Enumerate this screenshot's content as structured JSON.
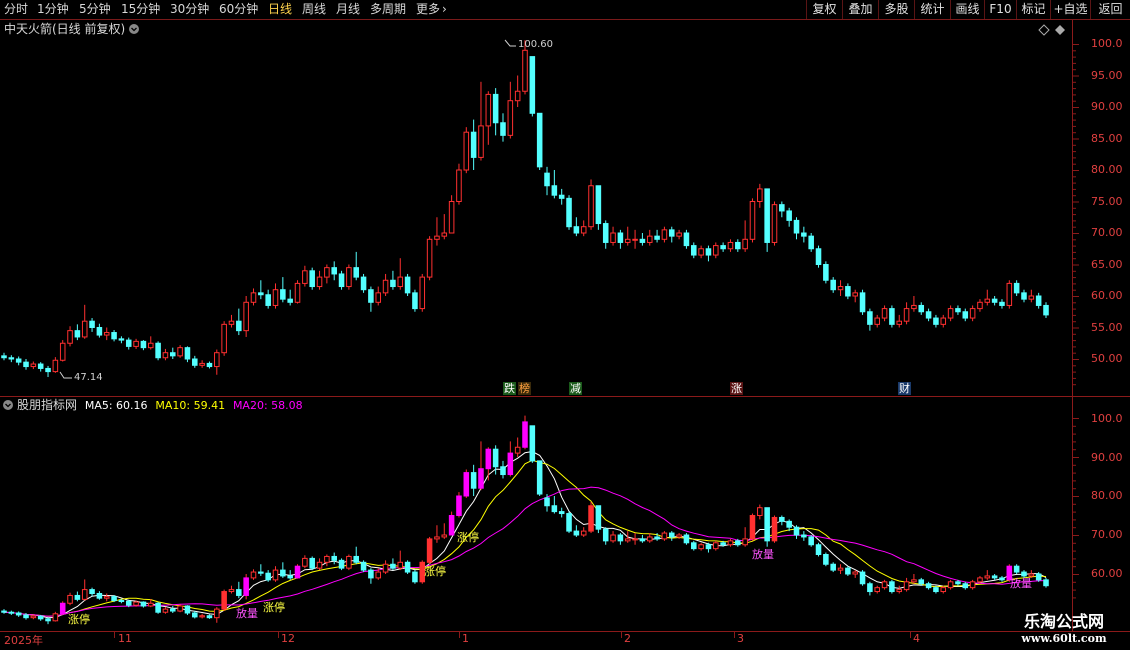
{
  "toolbar": {
    "periods": [
      {
        "label": "分时",
        "active": false
      },
      {
        "label": "1分钟",
        "active": false
      },
      {
        "label": "5分钟",
        "active": false
      },
      {
        "label": "15分钟",
        "active": false
      },
      {
        "label": "30分钟",
        "active": false
      },
      {
        "label": "60分钟",
        "active": false
      },
      {
        "label": "日线",
        "active": true
      },
      {
        "label": "周线",
        "active": false
      },
      {
        "label": "月线",
        "active": false
      },
      {
        "label": "多周期",
        "active": false
      }
    ],
    "more_label": "更多",
    "more_arrow": "›",
    "right_buttons": [
      "复权",
      "叠加",
      "多股",
      "统计",
      "画线",
      "F10",
      "标记",
      "+自选",
      "返回"
    ]
  },
  "main_panel": {
    "title": "中天火箭(日线 前复权)",
    "y_labels": [
      "100.0",
      "95.00",
      "90.00",
      "85.00",
      "80.00",
      "75.00",
      "70.00",
      "65.00",
      "60.00",
      "55.00",
      "50.00"
    ],
    "y_values": [
      100,
      95,
      90,
      85,
      80,
      75,
      70,
      65,
      60,
      55,
      50
    ],
    "high_label": "100.60",
    "low_label": "47.14",
    "events": [
      {
        "text": "跌",
        "bg": "#1a5a1a",
        "fg": "#ffffff"
      },
      {
        "text": "榜",
        "bg": "#3a2a0a",
        "fg": "#ffa040"
      },
      {
        "text": "减",
        "bg": "#1a5a1a",
        "fg": "#ffffff"
      },
      {
        "text": "涨",
        "bg": "#5a1414",
        "fg": "#ffffff"
      },
      {
        "text": "财",
        "bg": "#1a3a6a",
        "fg": "#ffffff"
      }
    ]
  },
  "indicator_panel": {
    "name": "股朋指标网",
    "ma5_label": "MA5: 60.16",
    "ma10_label": "MA10: 59.41",
    "ma20_label": "MA20: 58.08",
    "y_labels": [
      "100.0",
      "90.00",
      "80.00",
      "70.00",
      "60.00"
    ],
    "y_values": [
      100,
      90,
      80,
      70,
      60
    ],
    "zhangting_label": "涨停",
    "fangliang_label": "放量"
  },
  "date_axis": [
    "2025年",
    "11",
    "12",
    "1",
    "2",
    "3",
    "4"
  ],
  "watermark": {
    "line1": "乐淘公式网",
    "line2": "www.60lt.com"
  },
  "colors": {
    "up": "#ff3030",
    "down": "#54ffff",
    "ma5": "#ffffff",
    "ma10": "#ffff00",
    "ma20": "#ff00ff",
    "border": "#8b1a1a",
    "axis_text": "#e04040"
  },
  "chart_data": {
    "type": "candlestick",
    "title": "中天火箭(日线 前复权)",
    "y_range_main": [
      45,
      102
    ],
    "y_range_indicator": [
      52,
      102
    ],
    "candles": [
      {
        "o": 50.5,
        "c": 50.2,
        "h": 51.0,
        "l": 49.8
      },
      {
        "o": 50.2,
        "c": 50.0,
        "h": 50.6,
        "l": 49.5
      },
      {
        "o": 50.0,
        "c": 49.5,
        "h": 50.4,
        "l": 49.0
      },
      {
        "o": 49.5,
        "c": 48.8,
        "h": 50.0,
        "l": 48.3
      },
      {
        "o": 48.8,
        "c": 49.2,
        "h": 49.6,
        "l": 48.4
      },
      {
        "o": 49.2,
        "c": 48.5,
        "h": 49.5,
        "l": 48.0
      },
      {
        "o": 48.5,
        "c": 48.0,
        "h": 48.9,
        "l": 47.14
      },
      {
        "o": 48.0,
        "c": 49.8,
        "h": 50.3,
        "l": 47.8
      },
      {
        "o": 49.8,
        "c": 52.5,
        "h": 53.0,
        "l": 49.6
      },
      {
        "o": 52.5,
        "c": 54.5,
        "h": 55.2,
        "l": 52.0
      },
      {
        "o": 54.5,
        "c": 53.5,
        "h": 55.5,
        "l": 53.0
      },
      {
        "o": 53.5,
        "c": 56.0,
        "h": 58.6,
        "l": 53.2
      },
      {
        "o": 56.0,
        "c": 55.0,
        "h": 56.5,
        "l": 54.3
      },
      {
        "o": 55.0,
        "c": 53.8,
        "h": 55.6,
        "l": 53.4
      },
      {
        "o": 53.8,
        "c": 54.2,
        "h": 55.0,
        "l": 53.0
      },
      {
        "o": 54.2,
        "c": 53.2,
        "h": 54.6,
        "l": 52.8
      },
      {
        "o": 53.2,
        "c": 53.0,
        "h": 53.6,
        "l": 52.5
      },
      {
        "o": 53.0,
        "c": 52.0,
        "h": 53.4,
        "l": 51.5
      },
      {
        "o": 52.0,
        "c": 52.8,
        "h": 53.2,
        "l": 51.6
      },
      {
        "o": 52.8,
        "c": 51.8,
        "h": 53.0,
        "l": 51.4
      },
      {
        "o": 51.8,
        "c": 52.5,
        "h": 53.6,
        "l": 51.5
      },
      {
        "o": 52.5,
        "c": 50.2,
        "h": 52.8,
        "l": 49.8
      },
      {
        "o": 50.2,
        "c": 51.0,
        "h": 51.6,
        "l": 49.8
      },
      {
        "o": 51.0,
        "c": 50.5,
        "h": 51.8,
        "l": 50.0
      },
      {
        "o": 50.5,
        "c": 51.8,
        "h": 52.2,
        "l": 50.2
      },
      {
        "o": 51.8,
        "c": 50.0,
        "h": 52.0,
        "l": 49.5
      },
      {
        "o": 50.0,
        "c": 49.0,
        "h": 50.5,
        "l": 48.6
      },
      {
        "o": 49.0,
        "c": 49.3,
        "h": 49.8,
        "l": 48.6
      },
      {
        "o": 49.3,
        "c": 48.8,
        "h": 49.6,
        "l": 48.5
      },
      {
        "o": 48.8,
        "c": 51.0,
        "h": 51.5,
        "l": 47.5
      },
      {
        "o": 51.0,
        "c": 55.5,
        "h": 56.0,
        "l": 50.5
      },
      {
        "o": 55.5,
        "c": 56.0,
        "h": 57.0,
        "l": 55.0
      },
      {
        "o": 56.0,
        "c": 54.5,
        "h": 58.0,
        "l": 53.8
      },
      {
        "o": 54.5,
        "c": 59.0,
        "h": 60.0,
        "l": 53.5
      },
      {
        "o": 59.0,
        "c": 60.5,
        "h": 61.2,
        "l": 58.5
      },
      {
        "o": 60.5,
        "c": 60.2,
        "h": 62.5,
        "l": 59.5
      },
      {
        "o": 60.2,
        "c": 58.5,
        "h": 61.0,
        "l": 58.0
      },
      {
        "o": 58.5,
        "c": 61.0,
        "h": 62.0,
        "l": 58.0
      },
      {
        "o": 61.0,
        "c": 59.5,
        "h": 63.0,
        "l": 59.0
      },
      {
        "o": 59.5,
        "c": 59.0,
        "h": 61.0,
        "l": 58.5
      },
      {
        "o": 59.0,
        "c": 62.0,
        "h": 62.5,
        "l": 58.8
      },
      {
        "o": 62.0,
        "c": 64.0,
        "h": 64.8,
        "l": 61.5
      },
      {
        "o": 64.0,
        "c": 61.5,
        "h": 64.5,
        "l": 61.0
      },
      {
        "o": 61.5,
        "c": 63.0,
        "h": 64.0,
        "l": 61.0
      },
      {
        "o": 63.0,
        "c": 64.5,
        "h": 65.0,
        "l": 62.0
      },
      {
        "o": 64.5,
        "c": 63.5,
        "h": 65.5,
        "l": 62.5
      },
      {
        "o": 63.5,
        "c": 61.5,
        "h": 64.0,
        "l": 61.0
      },
      {
        "o": 61.5,
        "c": 64.5,
        "h": 65.0,
        "l": 61.0
      },
      {
        "o": 64.5,
        "c": 63.0,
        "h": 67.0,
        "l": 62.5
      },
      {
        "o": 63.0,
        "c": 61.0,
        "h": 63.5,
        "l": 60.5
      },
      {
        "o": 61.0,
        "c": 59.0,
        "h": 61.5,
        "l": 57.5
      },
      {
        "o": 59.0,
        "c": 60.5,
        "h": 61.5,
        "l": 58.5
      },
      {
        "o": 60.5,
        "c": 62.5,
        "h": 63.5,
        "l": 60.0
      },
      {
        "o": 62.5,
        "c": 61.5,
        "h": 64.0,
        "l": 61.0
      },
      {
        "o": 61.5,
        "c": 63.0,
        "h": 66.0,
        "l": 61.0
      },
      {
        "o": 63.0,
        "c": 60.5,
        "h": 63.5,
        "l": 60.0
      },
      {
        "o": 60.5,
        "c": 58.0,
        "h": 61.0,
        "l": 57.5
      },
      {
        "o": 58.0,
        "c": 63.0,
        "h": 63.5,
        "l": 57.5
      },
      {
        "o": 63.0,
        "c": 69.0,
        "h": 69.5,
        "l": 62.5
      },
      {
        "o": 69.0,
        "c": 69.5,
        "h": 72.5,
        "l": 68.0
      },
      {
        "o": 69.5,
        "c": 70.0,
        "h": 73.0,
        "l": 69.0
      },
      {
        "o": 70.0,
        "c": 75.0,
        "h": 76.0,
        "l": 70.0
      },
      {
        "o": 75.0,
        "c": 80.0,
        "h": 81.0,
        "l": 74.5
      },
      {
        "o": 80.0,
        "c": 86.0,
        "h": 86.8,
        "l": 79.5
      },
      {
        "o": 86.0,
        "c": 82.0,
        "h": 88.0,
        "l": 80.0
      },
      {
        "o": 82.0,
        "c": 87.0,
        "h": 94.0,
        "l": 81.5
      },
      {
        "o": 87.0,
        "c": 92.0,
        "h": 92.5,
        "l": 84.0
      },
      {
        "o": 92.0,
        "c": 87.5,
        "h": 93.0,
        "l": 85.5
      },
      {
        "o": 87.5,
        "c": 85.5,
        "h": 89.0,
        "l": 84.5
      },
      {
        "o": 85.5,
        "c": 91.0,
        "h": 94.0,
        "l": 85.0
      },
      {
        "o": 91.0,
        "c": 92.5,
        "h": 95.0,
        "l": 90.0
      },
      {
        "o": 92.5,
        "c": 99.0,
        "h": 100.6,
        "l": 92.0
      },
      {
        "o": 98.0,
        "c": 89.0,
        "h": 98.0,
        "l": 88.5
      },
      {
        "o": 89.0,
        "c": 80.5,
        "h": 89.0,
        "l": 80.0
      },
      {
        "o": 79.5,
        "c": 77.5,
        "h": 80.5,
        "l": 76.0
      },
      {
        "o": 77.5,
        "c": 76.0,
        "h": 80.0,
        "l": 75.5
      },
      {
        "o": 76.0,
        "c": 75.5,
        "h": 77.0,
        "l": 74.5
      },
      {
        "o": 75.5,
        "c": 71.0,
        "h": 76.0,
        "l": 70.5
      },
      {
        "o": 71.0,
        "c": 70.0,
        "h": 72.5,
        "l": 69.5
      },
      {
        "o": 70.0,
        "c": 71.0,
        "h": 72.0,
        "l": 69.5
      },
      {
        "o": 71.0,
        "c": 77.5,
        "h": 78.5,
        "l": 70.5
      },
      {
        "o": 77.5,
        "c": 71.5,
        "h": 77.5,
        "l": 70.5
      },
      {
        "o": 71.5,
        "c": 68.5,
        "h": 72.0,
        "l": 67.5
      },
      {
        "o": 68.5,
        "c": 70.0,
        "h": 71.0,
        "l": 68.0
      },
      {
        "o": 70.0,
        "c": 68.5,
        "h": 70.5,
        "l": 67.5
      },
      {
        "o": 68.5,
        "c": 69.0,
        "h": 71.0,
        "l": 68.0
      },
      {
        "o": 69.0,
        "c": 69.0,
        "h": 70.5,
        "l": 67.5
      },
      {
        "o": 69.0,
        "c": 68.5,
        "h": 70.0,
        "l": 68.0
      },
      {
        "o": 68.5,
        "c": 69.5,
        "h": 70.5,
        "l": 68.0
      },
      {
        "o": 69.5,
        "c": 69.0,
        "h": 70.5,
        "l": 68.5
      },
      {
        "o": 69.0,
        "c": 70.5,
        "h": 71.0,
        "l": 68.5
      },
      {
        "o": 70.5,
        "c": 69.5,
        "h": 71.0,
        "l": 68.5
      },
      {
        "o": 69.5,
        "c": 70.0,
        "h": 70.5,
        "l": 69.0
      },
      {
        "o": 70.0,
        "c": 68.0,
        "h": 70.5,
        "l": 67.5
      },
      {
        "o": 68.0,
        "c": 66.5,
        "h": 68.5,
        "l": 66.0
      },
      {
        "o": 66.5,
        "c": 67.5,
        "h": 68.0,
        "l": 66.0
      },
      {
        "o": 67.5,
        "c": 66.5,
        "h": 68.0,
        "l": 65.5
      },
      {
        "o": 66.5,
        "c": 68.0,
        "h": 68.5,
        "l": 66.0
      },
      {
        "o": 68.0,
        "c": 67.5,
        "h": 68.5,
        "l": 67.0
      },
      {
        "o": 67.5,
        "c": 68.5,
        "h": 69.0,
        "l": 67.0
      },
      {
        "o": 68.5,
        "c": 67.5,
        "h": 69.0,
        "l": 67.0
      },
      {
        "o": 67.5,
        "c": 69.0,
        "h": 72.0,
        "l": 67.0
      },
      {
        "o": 69.0,
        "c": 75.0,
        "h": 75.5,
        "l": 68.5
      },
      {
        "o": 75.0,
        "c": 77.0,
        "h": 77.8,
        "l": 74.0
      },
      {
        "o": 77.0,
        "c": 68.5,
        "h": 77.0,
        "l": 67.0
      },
      {
        "o": 68.5,
        "c": 74.5,
        "h": 75.0,
        "l": 68.0
      },
      {
        "o": 74.5,
        "c": 73.5,
        "h": 75.0,
        "l": 72.5
      },
      {
        "o": 73.5,
        "c": 72.0,
        "h": 74.0,
        "l": 71.0
      },
      {
        "o": 72.0,
        "c": 70.0,
        "h": 72.5,
        "l": 69.0
      },
      {
        "o": 70.0,
        "c": 69.5,
        "h": 71.0,
        "l": 68.5
      },
      {
        "o": 69.5,
        "c": 67.5,
        "h": 70.0,
        "l": 67.0
      },
      {
        "o": 67.5,
        "c": 65.0,
        "h": 68.0,
        "l": 64.5
      },
      {
        "o": 65.0,
        "c": 62.5,
        "h": 65.5,
        "l": 62.0
      },
      {
        "o": 62.5,
        "c": 61.0,
        "h": 63.0,
        "l": 60.5
      },
      {
        "o": 61.0,
        "c": 61.5,
        "h": 62.5,
        "l": 60.0
      },
      {
        "o": 61.5,
        "c": 60.0,
        "h": 62.0,
        "l": 59.5
      },
      {
        "o": 60.0,
        "c": 60.5,
        "h": 61.0,
        "l": 59.0
      },
      {
        "o": 60.5,
        "c": 57.5,
        "h": 61.0,
        "l": 57.0
      },
      {
        "o": 57.5,
        "c": 55.5,
        "h": 58.0,
        "l": 54.5
      },
      {
        "o": 55.5,
        "c": 56.5,
        "h": 57.0,
        "l": 55.0
      },
      {
        "o": 56.5,
        "c": 58.0,
        "h": 58.5,
        "l": 56.0
      },
      {
        "o": 58.0,
        "c": 55.5,
        "h": 58.5,
        "l": 55.0
      },
      {
        "o": 55.5,
        "c": 56.0,
        "h": 57.0,
        "l": 55.0
      },
      {
        "o": 56.0,
        "c": 58.0,
        "h": 59.0,
        "l": 55.5
      },
      {
        "o": 58.0,
        "c": 58.5,
        "h": 60.0,
        "l": 57.5
      },
      {
        "o": 58.5,
        "c": 57.5,
        "h": 59.0,
        "l": 57.0
      },
      {
        "o": 57.5,
        "c": 56.5,
        "h": 58.0,
        "l": 56.0
      },
      {
        "o": 56.5,
        "c": 55.5,
        "h": 57.0,
        "l": 55.0
      },
      {
        "o": 55.5,
        "c": 56.5,
        "h": 57.0,
        "l": 55.0
      },
      {
        "o": 56.5,
        "c": 58.0,
        "h": 58.5,
        "l": 56.0
      },
      {
        "o": 58.0,
        "c": 57.5,
        "h": 58.5,
        "l": 57.0
      },
      {
        "o": 57.5,
        "c": 56.5,
        "h": 58.0,
        "l": 56.0
      },
      {
        "o": 56.5,
        "c": 58.0,
        "h": 58.5,
        "l": 56.0
      },
      {
        "o": 58.0,
        "c": 59.0,
        "h": 59.5,
        "l": 57.5
      },
      {
        "o": 59.0,
        "c": 59.5,
        "h": 61.0,
        "l": 58.5
      },
      {
        "o": 59.5,
        "c": 59.0,
        "h": 60.0,
        "l": 58.5
      },
      {
        "o": 59.0,
        "c": 58.5,
        "h": 59.5,
        "l": 58.0
      },
      {
        "o": 58.5,
        "c": 62.0,
        "h": 62.5,
        "l": 58.0
      },
      {
        "o": 62.0,
        "c": 60.5,
        "h": 62.5,
        "l": 60.0
      },
      {
        "o": 60.5,
        "c": 59.5,
        "h": 61.0,
        "l": 59.0
      },
      {
        "o": 59.5,
        "c": 60.0,
        "h": 61.0,
        "l": 59.0
      },
      {
        "o": 60.0,
        "c": 58.5,
        "h": 60.5,
        "l": 58.0
      },
      {
        "o": 58.5,
        "c": 57.0,
        "h": 59.0,
        "l": 56.5
      }
    ]
  }
}
